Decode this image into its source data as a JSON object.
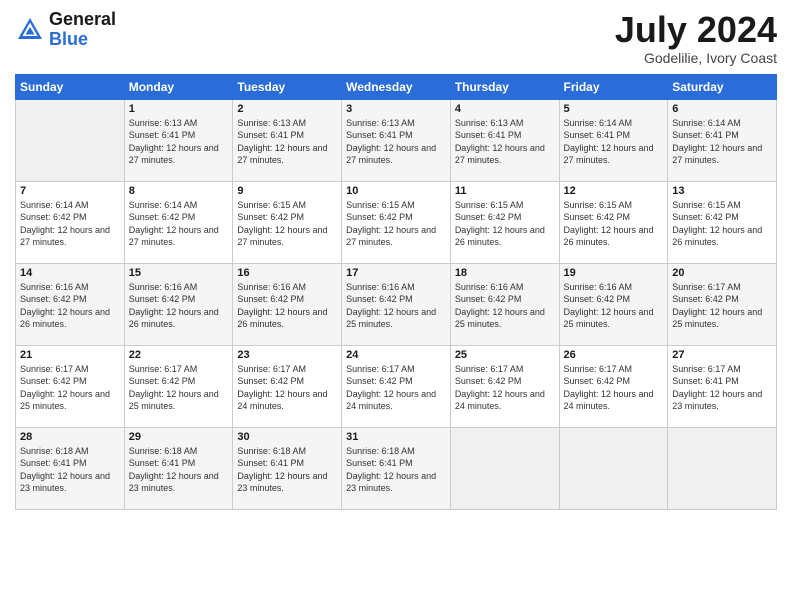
{
  "header": {
    "logo_general": "General",
    "logo_blue": "Blue",
    "month_year": "July 2024",
    "location": "Godelilie, Ivory Coast"
  },
  "days_of_week": [
    "Sunday",
    "Monday",
    "Tuesday",
    "Wednesday",
    "Thursday",
    "Friday",
    "Saturday"
  ],
  "weeks": [
    [
      {
        "day": "",
        "sunrise": "",
        "sunset": "",
        "daylight": ""
      },
      {
        "day": "1",
        "sunrise": "6:13 AM",
        "sunset": "6:41 PM",
        "daylight": "12 hours and 27 minutes."
      },
      {
        "day": "2",
        "sunrise": "6:13 AM",
        "sunset": "6:41 PM",
        "daylight": "12 hours and 27 minutes."
      },
      {
        "day": "3",
        "sunrise": "6:13 AM",
        "sunset": "6:41 PM",
        "daylight": "12 hours and 27 minutes."
      },
      {
        "day": "4",
        "sunrise": "6:13 AM",
        "sunset": "6:41 PM",
        "daylight": "12 hours and 27 minutes."
      },
      {
        "day": "5",
        "sunrise": "6:14 AM",
        "sunset": "6:41 PM",
        "daylight": "12 hours and 27 minutes."
      },
      {
        "day": "6",
        "sunrise": "6:14 AM",
        "sunset": "6:41 PM",
        "daylight": "12 hours and 27 minutes."
      }
    ],
    [
      {
        "day": "7",
        "sunrise": "6:14 AM",
        "sunset": "6:42 PM",
        "daylight": "12 hours and 27 minutes."
      },
      {
        "day": "8",
        "sunrise": "6:14 AM",
        "sunset": "6:42 PM",
        "daylight": "12 hours and 27 minutes."
      },
      {
        "day": "9",
        "sunrise": "6:15 AM",
        "sunset": "6:42 PM",
        "daylight": "12 hours and 27 minutes."
      },
      {
        "day": "10",
        "sunrise": "6:15 AM",
        "sunset": "6:42 PM",
        "daylight": "12 hours and 27 minutes."
      },
      {
        "day": "11",
        "sunrise": "6:15 AM",
        "sunset": "6:42 PM",
        "daylight": "12 hours and 26 minutes."
      },
      {
        "day": "12",
        "sunrise": "6:15 AM",
        "sunset": "6:42 PM",
        "daylight": "12 hours and 26 minutes."
      },
      {
        "day": "13",
        "sunrise": "6:15 AM",
        "sunset": "6:42 PM",
        "daylight": "12 hours and 26 minutes."
      }
    ],
    [
      {
        "day": "14",
        "sunrise": "6:16 AM",
        "sunset": "6:42 PM",
        "daylight": "12 hours and 26 minutes."
      },
      {
        "day": "15",
        "sunrise": "6:16 AM",
        "sunset": "6:42 PM",
        "daylight": "12 hours and 26 minutes."
      },
      {
        "day": "16",
        "sunrise": "6:16 AM",
        "sunset": "6:42 PM",
        "daylight": "12 hours and 26 minutes."
      },
      {
        "day": "17",
        "sunrise": "6:16 AM",
        "sunset": "6:42 PM",
        "daylight": "12 hours and 25 minutes."
      },
      {
        "day": "18",
        "sunrise": "6:16 AM",
        "sunset": "6:42 PM",
        "daylight": "12 hours and 25 minutes."
      },
      {
        "day": "19",
        "sunrise": "6:16 AM",
        "sunset": "6:42 PM",
        "daylight": "12 hours and 25 minutes."
      },
      {
        "day": "20",
        "sunrise": "6:17 AM",
        "sunset": "6:42 PM",
        "daylight": "12 hours and 25 minutes."
      }
    ],
    [
      {
        "day": "21",
        "sunrise": "6:17 AM",
        "sunset": "6:42 PM",
        "daylight": "12 hours and 25 minutes."
      },
      {
        "day": "22",
        "sunrise": "6:17 AM",
        "sunset": "6:42 PM",
        "daylight": "12 hours and 25 minutes."
      },
      {
        "day": "23",
        "sunrise": "6:17 AM",
        "sunset": "6:42 PM",
        "daylight": "12 hours and 24 minutes."
      },
      {
        "day": "24",
        "sunrise": "6:17 AM",
        "sunset": "6:42 PM",
        "daylight": "12 hours and 24 minutes."
      },
      {
        "day": "25",
        "sunrise": "6:17 AM",
        "sunset": "6:42 PM",
        "daylight": "12 hours and 24 minutes."
      },
      {
        "day": "26",
        "sunrise": "6:17 AM",
        "sunset": "6:42 PM",
        "daylight": "12 hours and 24 minutes."
      },
      {
        "day": "27",
        "sunrise": "6:17 AM",
        "sunset": "6:41 PM",
        "daylight": "12 hours and 23 minutes."
      }
    ],
    [
      {
        "day": "28",
        "sunrise": "6:18 AM",
        "sunset": "6:41 PM",
        "daylight": "12 hours and 23 minutes."
      },
      {
        "day": "29",
        "sunrise": "6:18 AM",
        "sunset": "6:41 PM",
        "daylight": "12 hours and 23 minutes."
      },
      {
        "day": "30",
        "sunrise": "6:18 AM",
        "sunset": "6:41 PM",
        "daylight": "12 hours and 23 minutes."
      },
      {
        "day": "31",
        "sunrise": "6:18 AM",
        "sunset": "6:41 PM",
        "daylight": "12 hours and 23 minutes."
      },
      {
        "day": "",
        "sunrise": "",
        "sunset": "",
        "daylight": ""
      },
      {
        "day": "",
        "sunrise": "",
        "sunset": "",
        "daylight": ""
      },
      {
        "day": "",
        "sunrise": "",
        "sunset": "",
        "daylight": ""
      }
    ]
  ]
}
